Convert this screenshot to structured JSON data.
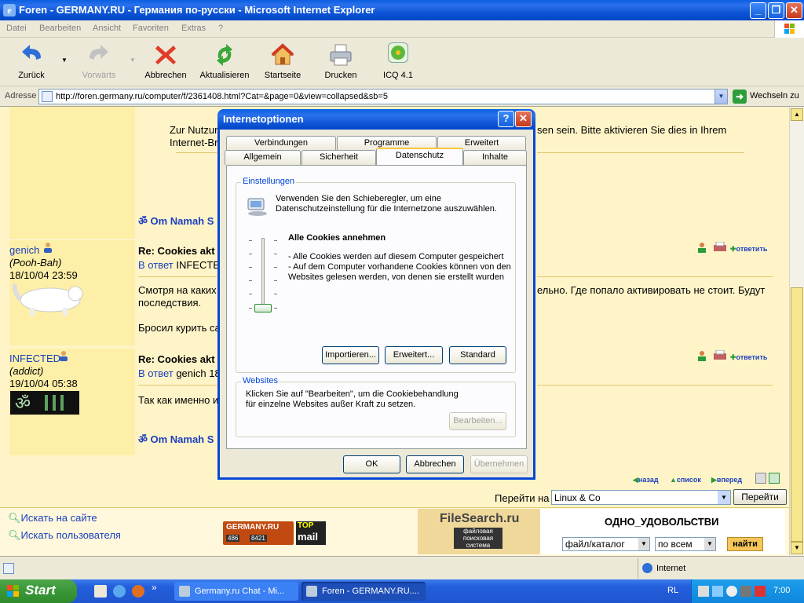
{
  "window": {
    "title": "Foren - GERMANY.RU - Германия по-русски - Microsoft Internet Explorer",
    "icon": "ie-page-icon"
  },
  "menu": [
    "Datei",
    "Bearbeiten",
    "Ansicht",
    "Favoriten",
    "Extras",
    "?"
  ],
  "toolbar": {
    "back": "Zurück",
    "forward": "Vorwärts",
    "stop": "Abbrechen",
    "refresh": "Aktualisieren",
    "home": "Startseite",
    "print": "Drucken",
    "icq": "ICQ 4.1"
  },
  "address": {
    "label": "Adresse",
    "url": "http://foren.germany.ru/computer/f/2361408.html?Cat=&page=0&view=collapsed&sb=5",
    "go": "Wechseln zu"
  },
  "forum": {
    "top_text_1": "Zur Nutzun",
    "top_text_1_tail": "sen sein. Bitte aktivieren Sie dies in Ihrem",
    "top_text_2": "Internet-Br",
    "signature": "Om Namah S",
    "posts": [
      {
        "user": "genich",
        "rank": "(Pooh-Bah)",
        "date": "18/10/04 23:59",
        "subject": "Re: Cookies akt",
        "reply_label": "В ответ",
        "reply_to": "INFECTED",
        "body_1": "Смотря на каких",
        "body_1_tail": "ельно. Где попало активировать не стоит. Будут",
        "body_2": "последствия.",
        "body_3": "Бросил курить са"
      },
      {
        "user": "INFECTED",
        "rank": "(addict)",
        "date": "19/10/04 05:38",
        "subject": "Re: Cookies akt",
        "reply_label": "В ответ",
        "reply_to": "genich 18",
        "body_1": "Так как именно и"
      }
    ],
    "reply_button": "ответить",
    "nav": [
      "назад",
      "список",
      "вперед"
    ],
    "goto_label": "Перейти на",
    "goto_value": "Linux & Co",
    "goto_button": "Перейти",
    "search_site": "Искать на сайте",
    "search_user": "Искать пользователя",
    "banner_germany": "GERMANY.RU",
    "banner_count_1": "486",
    "banner_count_2": "8421",
    "banner_top": "TOP",
    "banner_mail": "mail",
    "filesearch_title": "FileSearch.ru",
    "filesearch_sub": "файловая поисковая система",
    "filesearch_slogan": "ОДНО_УДОВОЛЬСТВИ",
    "filesearch_select_1": "файл/каталог",
    "filesearch_select_2": "по всем",
    "filesearch_button": "найти"
  },
  "status": {
    "zone": "Internet"
  },
  "taskbar": {
    "start": "Start",
    "tasks": [
      "Germany.ru Chat - Mi...",
      "Foren - GERMANY.RU...."
    ],
    "lang": "RL",
    "time": "7:00"
  },
  "dialog": {
    "title": "Internetoptionen",
    "tabs_row1": [
      "Verbindungen",
      "Programme",
      "Erweitert"
    ],
    "tabs_row2": [
      "Allgemein",
      "Sicherheit",
      "Datenschutz",
      "Inhalte"
    ],
    "group_settings": "Einstellungen",
    "intro_1": "Verwenden Sie den Schieberegler, um eine",
    "intro_2": "Datenschutzeinstellung für die Internetzone auszuwählen.",
    "level_title": "Alle Cookies annehmen",
    "desc_1": "- Alle Cookies werden auf diesem Computer gespeichert",
    "desc_2": "- Auf dem Computer vorhandene Cookies können von den",
    "desc_3": "Websites gelesen werden, von denen sie erstellt wurden",
    "slider_level": 0,
    "btn_import": "Importieren...",
    "btn_advanced": "Erweitert...",
    "btn_default": "Standard",
    "group_websites": "Websites",
    "websites_1": "Klicken Sie auf \"Bearbeiten\", um die Cookiebehandlung",
    "websites_2": "für einzelne Websites außer Kraft zu setzen.",
    "btn_edit": "Bearbeiten...",
    "btn_ok": "OK",
    "btn_cancel": "Abbrechen",
    "btn_apply": "Übernehmen"
  }
}
